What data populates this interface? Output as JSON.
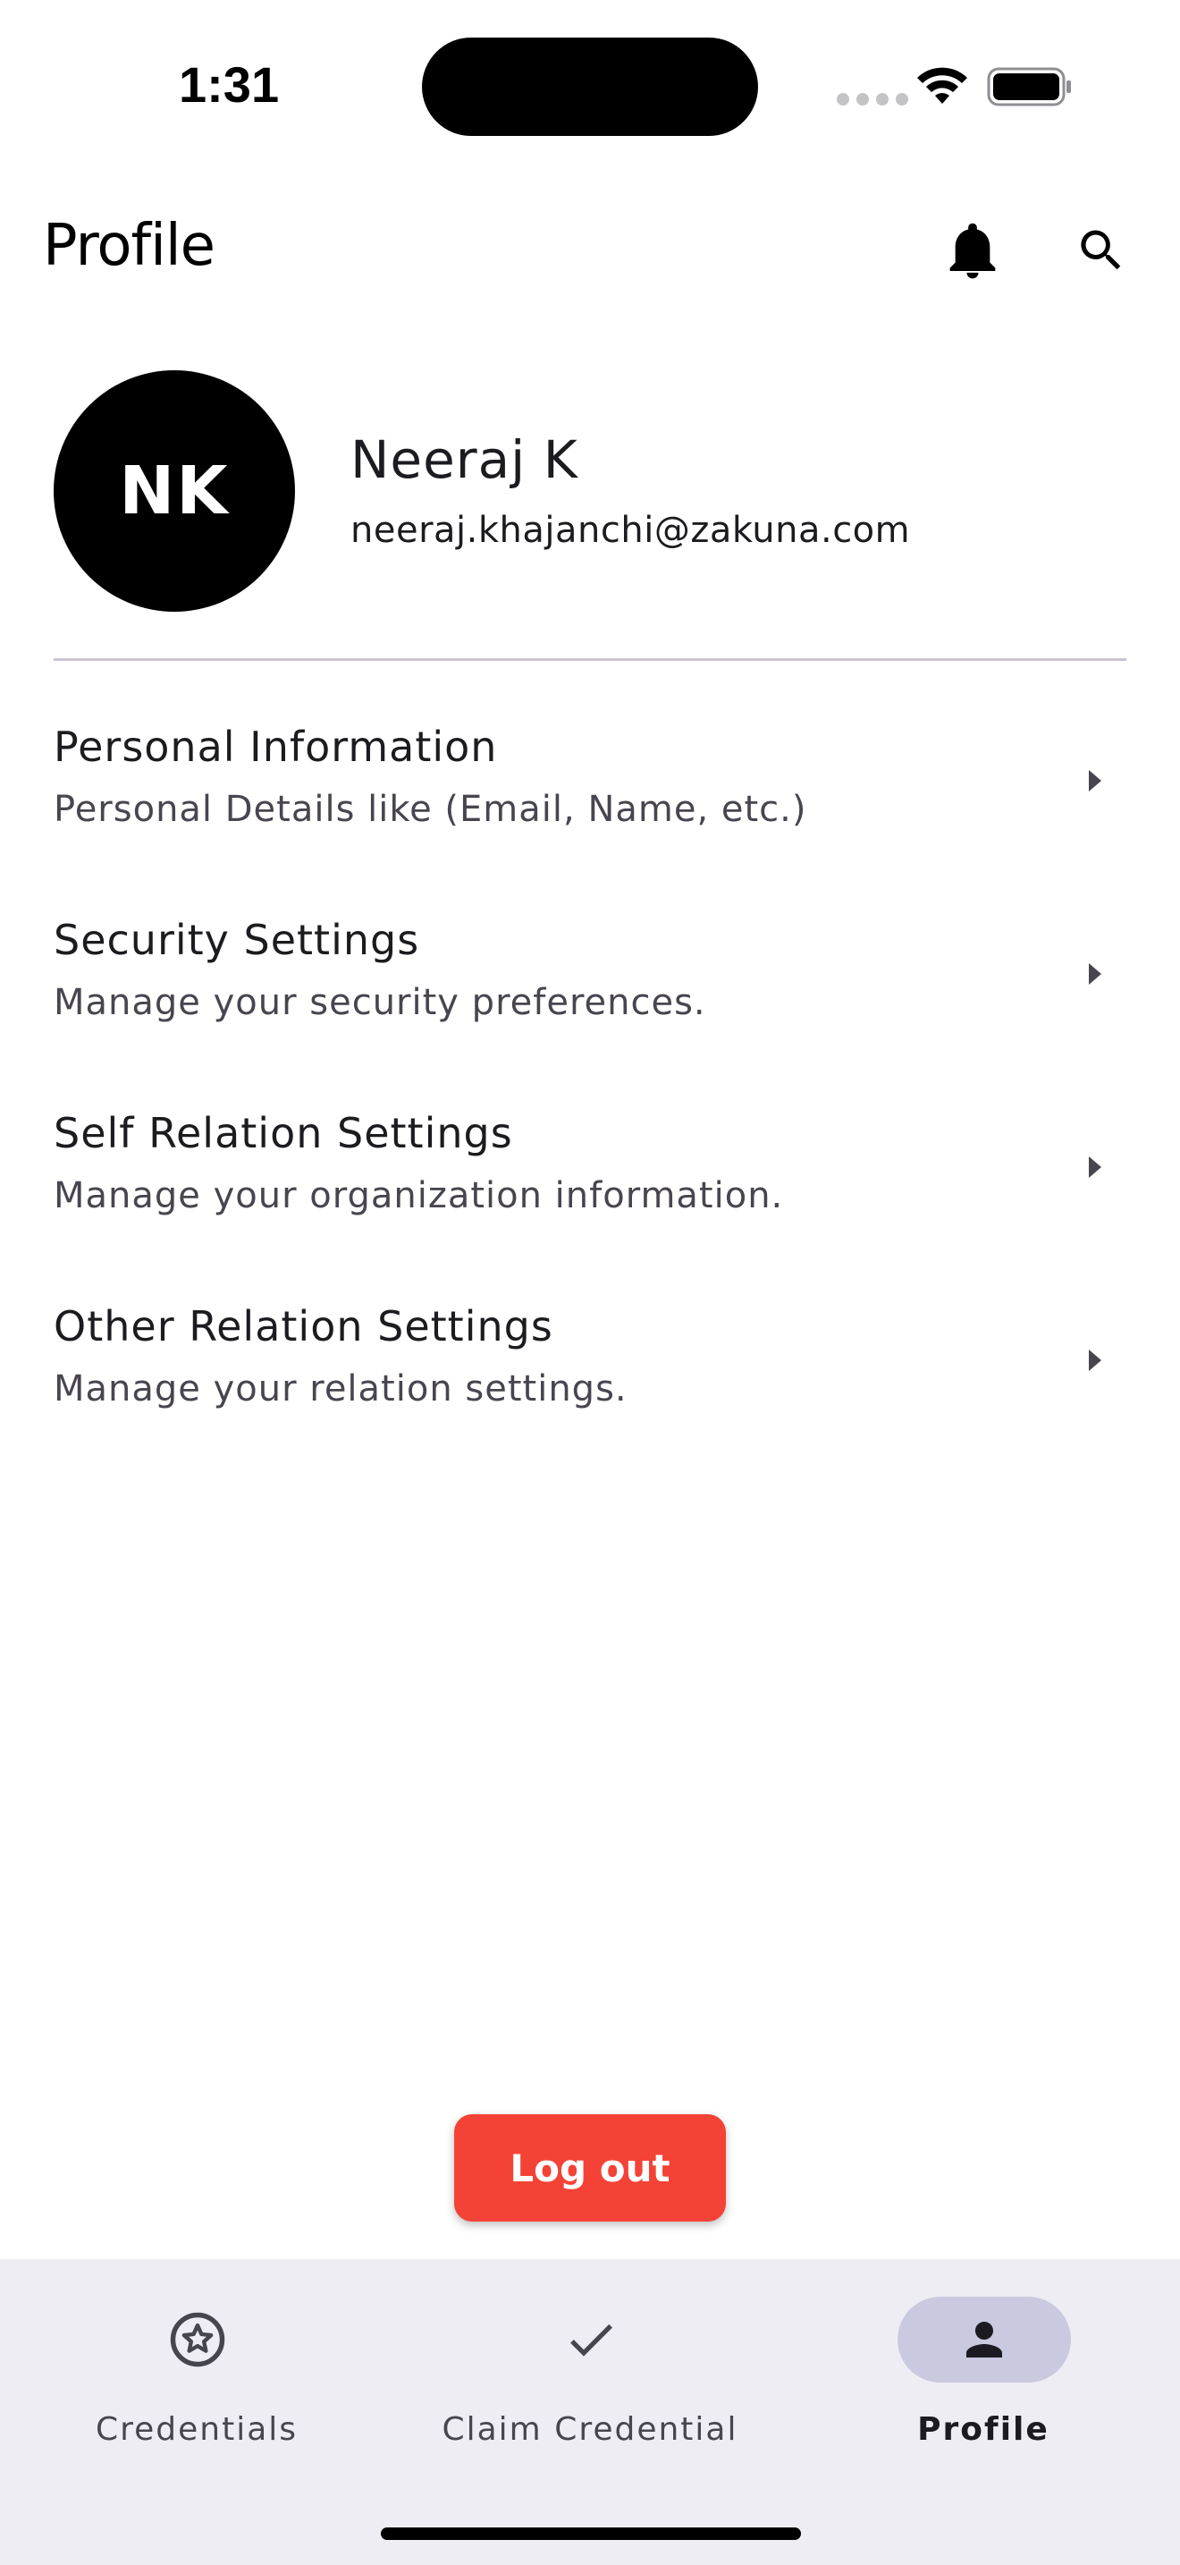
{
  "status_bar": {
    "time": "1:31"
  },
  "app_bar": {
    "title": "Profile",
    "actions": [
      "bell-icon",
      "search-icon"
    ]
  },
  "profile": {
    "initials": "NK",
    "name": "Neeraj K",
    "email": "neeraj.khajanchi@zakuna.com"
  },
  "settings": {
    "items": [
      {
        "title": "Personal Information",
        "subtitle": "Personal Details like (Email, Name, etc.)"
      },
      {
        "title": "Security Settings",
        "subtitle": "Manage your security preferences."
      },
      {
        "title": "Self Relation Settings",
        "subtitle": "Manage your organization information."
      },
      {
        "title": "Other Relation Settings",
        "subtitle": "Manage your relation settings."
      }
    ]
  },
  "logout": {
    "label": "Log out",
    "color": "#f44336"
  },
  "bottom_nav": {
    "items": [
      {
        "label": "Credentials",
        "icon": "star-badge-icon",
        "active": false
      },
      {
        "label": "Claim Credential",
        "icon": "checkmark-icon",
        "active": false
      },
      {
        "label": "Profile",
        "icon": "person-icon",
        "active": true
      }
    ],
    "active_indicator_color": "#c9c9df"
  }
}
